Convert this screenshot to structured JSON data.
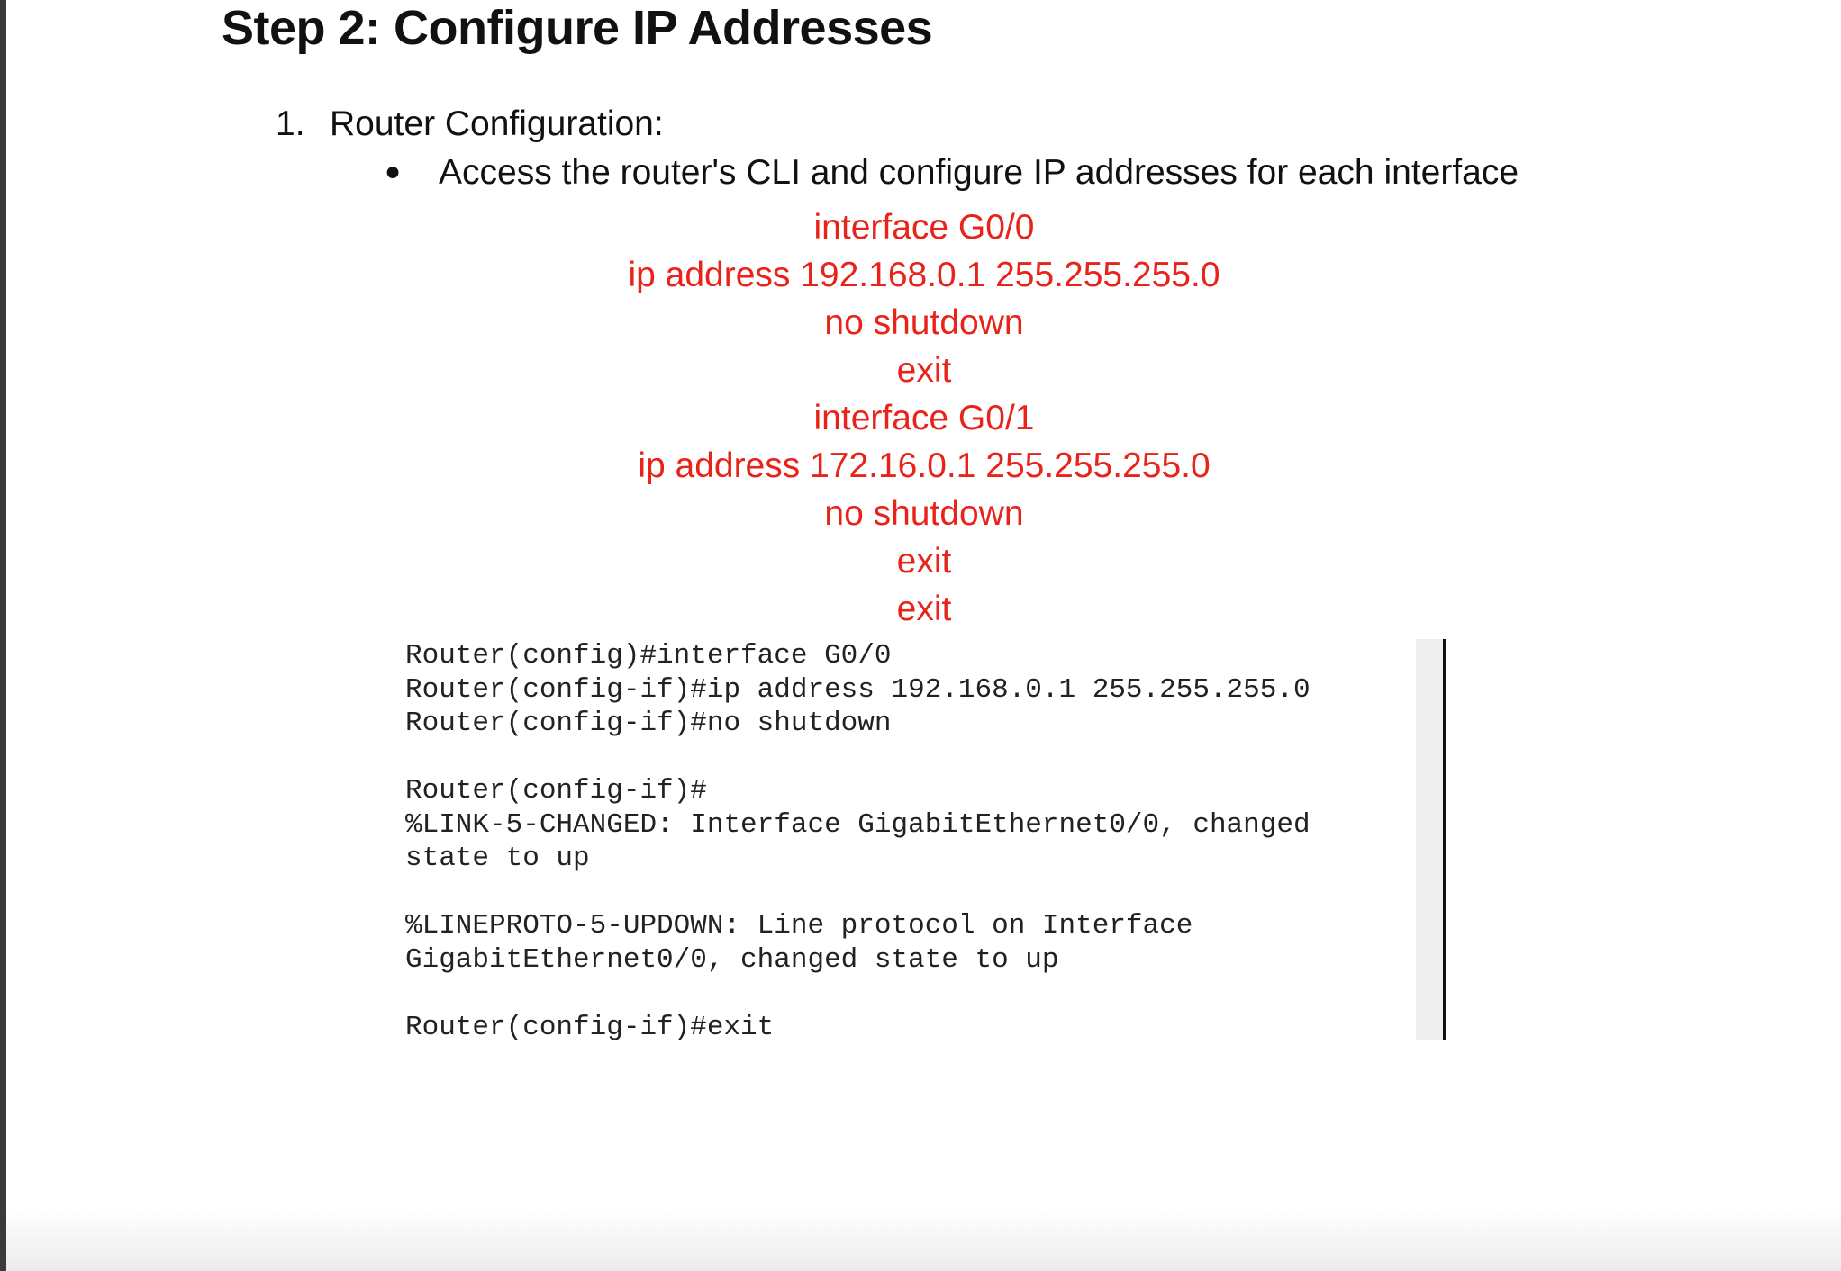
{
  "document": {
    "title": "Step 2: Configure IP Addresses",
    "step": {
      "number": "1.",
      "label": "Router Configuration:"
    },
    "bullet": {
      "marker": "●",
      "text": "Access the router's CLI and configure IP addresses for each interface"
    },
    "commands": [
      "interface G0/0",
      "ip address 192.168.0.1 255.255.255.0",
      "no shutdown",
      "exit",
      "interface G0/1",
      "ip address 172.16.0.1 255.255.255.0",
      "no shutdown",
      "exit",
      "exit"
    ],
    "command_color": "#e8231a",
    "terminal_lines": [
      "Router(config)#interface G0/0",
      "Router(config-if)#ip address 192.168.0.1 255.255.255.0",
      "Router(config-if)#no shutdown",
      "",
      "Router(config-if)#",
      "%LINK-5-CHANGED: Interface GigabitEthernet0/0, changed",
      "state to up",
      "",
      "%LINEPROTO-5-UPDOWN: Line protocol on Interface",
      "GigabitEthernet0/0, changed state to up",
      "",
      "Router(config-if)#exit"
    ]
  }
}
